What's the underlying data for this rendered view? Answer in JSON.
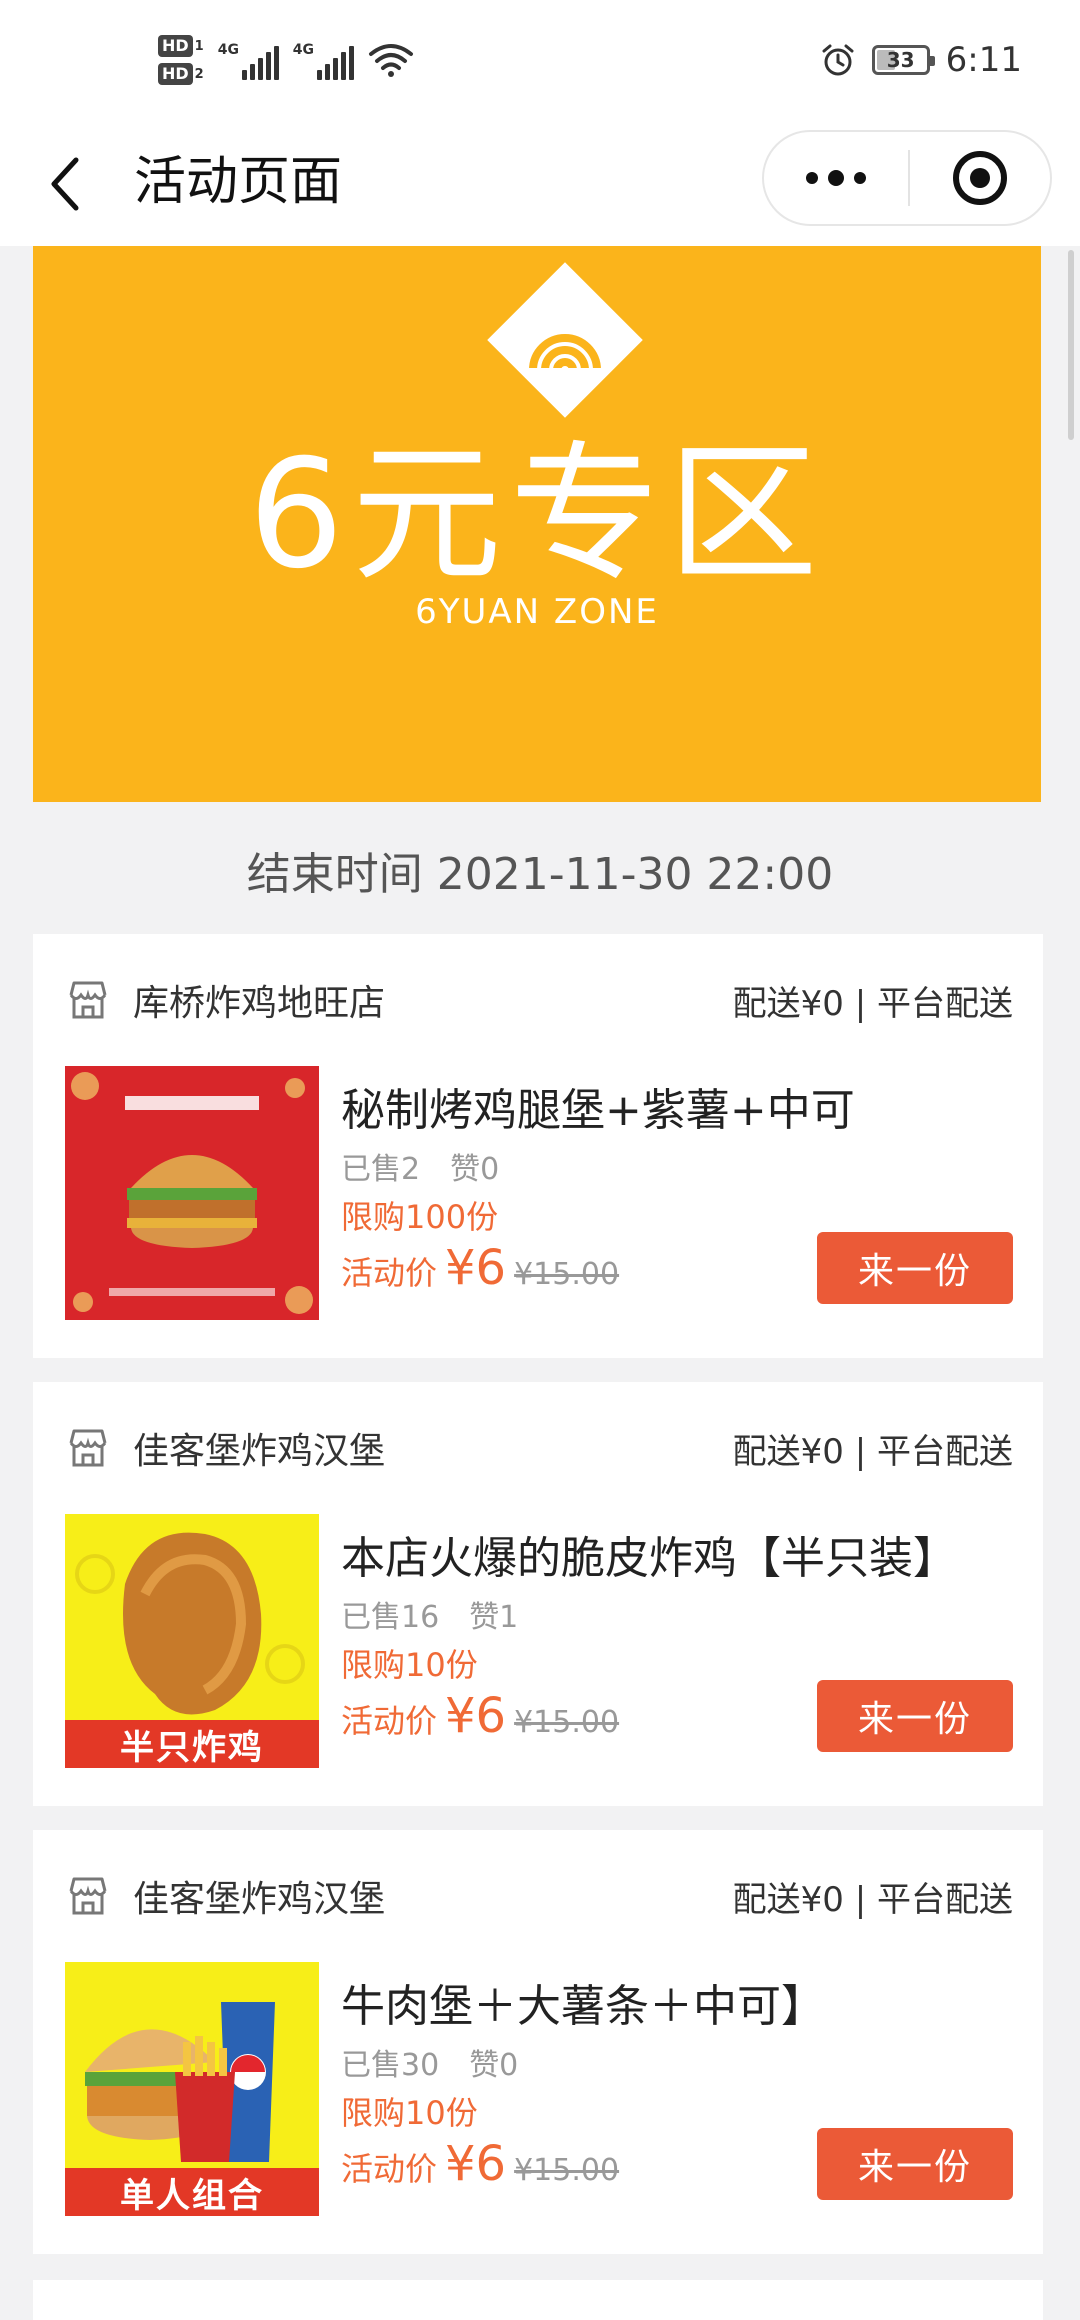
{
  "status_bar": {
    "hd1": "HD",
    "hd1_num": "1",
    "hd2": "HD",
    "hd2_num": "2",
    "net1": "4G",
    "net2": "4G",
    "battery": "33",
    "time": "6:11"
  },
  "nav": {
    "title": "活动页面"
  },
  "banner": {
    "title": "6元专区",
    "subtitle": "6YUAN ZONE",
    "bg_color": "#fbb41b"
  },
  "end_time": "结束时间 2021-11-30 22:00",
  "colors": {
    "accent": "#eb5a37",
    "price": "#f06a36"
  },
  "items": [
    {
      "shop": "库桥炸鸡地旺店",
      "delivery": "配送¥0 | 平台配送",
      "name": "秘制烤鸡腿堡+紫薯+中可",
      "sold": "已售2",
      "likes": "赞0",
      "limit": "限购100份",
      "price_label": "活动价",
      "price": "¥6",
      "orig_price": "¥15.00",
      "button": "来一份",
      "thumb_caption": ""
    },
    {
      "shop": "佳客堡炸鸡汉堡",
      "delivery": "配送¥0 | 平台配送",
      "name": "本店火爆的脆皮炸鸡【半只装】",
      "sold": "已售16",
      "likes": "赞1",
      "limit": "限购10份",
      "price_label": "活动价",
      "price": "¥6",
      "orig_price": "¥15.00",
      "button": "来一份",
      "thumb_caption": "半只炸鸡"
    },
    {
      "shop": "佳客堡炸鸡汉堡",
      "delivery": "配送¥0 | 平台配送",
      "name": "牛肉堡＋大薯条＋中可】",
      "sold": "已售30",
      "likes": "赞0",
      "limit": "限购10份",
      "price_label": "活动价",
      "price": "¥6",
      "orig_price": "¥15.00",
      "button": "来一份",
      "thumb_caption": "单人组合"
    }
  ]
}
